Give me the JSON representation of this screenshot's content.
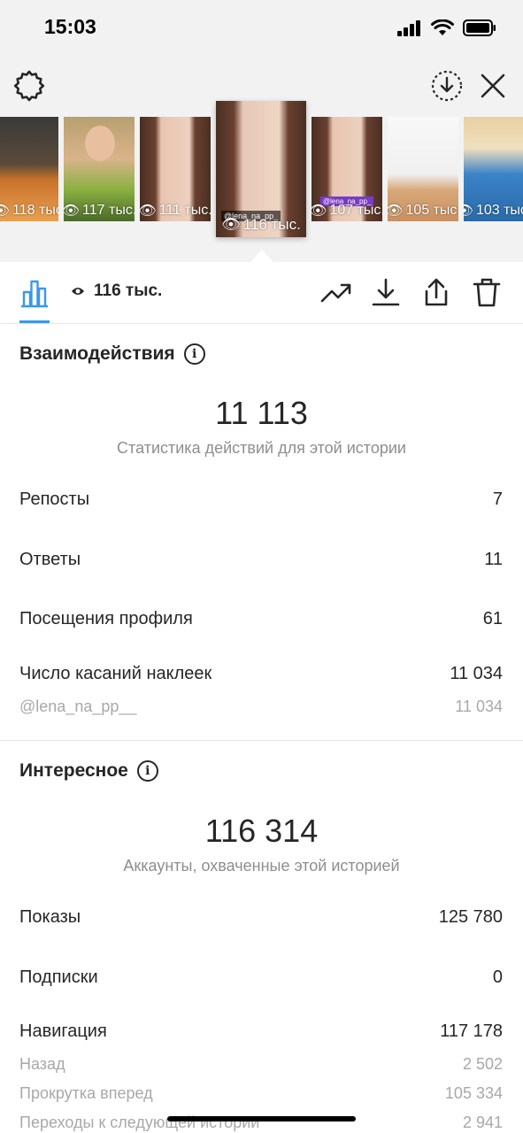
{
  "status_bar": {
    "time": "15:03"
  },
  "thumbnails": [
    {
      "views": "118 тыс.",
      "colors": [
        "#c8722a",
        "#3a3a3a"
      ]
    },
    {
      "views": "117 тыс.",
      "colors": [
        "#d9a779",
        "#5a7a3a"
      ]
    },
    {
      "views": "111 тыс.",
      "colors": [
        "#e8c5b0",
        "#4a2f22"
      ]
    },
    {
      "views": "116 тыс.",
      "sticker": "@lena_na_pp_",
      "colors": [
        "#e8c8b8",
        "#4a2f22"
      ]
    },
    {
      "views": "107 тыс.",
      "sticker": "@lena_na_pp_",
      "colors": [
        "#e8c5b0",
        "#4a2f22"
      ]
    },
    {
      "views": "105 тыс.",
      "colors": [
        "#f5f5f5",
        "#d8a878"
      ]
    },
    {
      "views": "103 тыс.",
      "colors": [
        "#3b83c8",
        "#e8a040"
      ]
    }
  ],
  "action_bar": {
    "views": "116 тыс."
  },
  "interactions": {
    "title": "Взаимодействия",
    "total": "11 113",
    "caption": "Статистика действий для этой истории",
    "rows": [
      {
        "label": "Репосты",
        "value": "7"
      },
      {
        "label": "Ответы",
        "value": "11"
      },
      {
        "label": "Посещения профиля",
        "value": "61"
      },
      {
        "label": "Число касаний наклеек",
        "value": "11 034"
      }
    ],
    "sub_rows": [
      {
        "label": "@lena_na_pp__",
        "value": "11 034"
      }
    ]
  },
  "discovery": {
    "title": "Интересное",
    "total": "116 314",
    "caption": "Аккаунты, охваченные этой историей",
    "rows": [
      {
        "label": "Показы",
        "value": "125 780"
      },
      {
        "label": "Подписки",
        "value": "0"
      },
      {
        "label": "Навигация",
        "value": "117 178"
      }
    ],
    "sub_rows": [
      {
        "label": "Назад",
        "value": "2 502"
      },
      {
        "label": "Прокрутка вперед",
        "value": "105 334"
      },
      {
        "label": "Переходы к следующей истории",
        "value": "2 941"
      }
    ]
  },
  "colors": {
    "accent": "#3897f0",
    "text": "#262626",
    "muted": "#8e8e8e",
    "header_bg": "#f2f2f2"
  },
  "icons": [
    "gear-icon",
    "save-icon",
    "close-icon",
    "bar-chart-icon",
    "eye-icon",
    "trend-icon",
    "download-icon",
    "share-icon",
    "trash-icon",
    "info-icon"
  ]
}
